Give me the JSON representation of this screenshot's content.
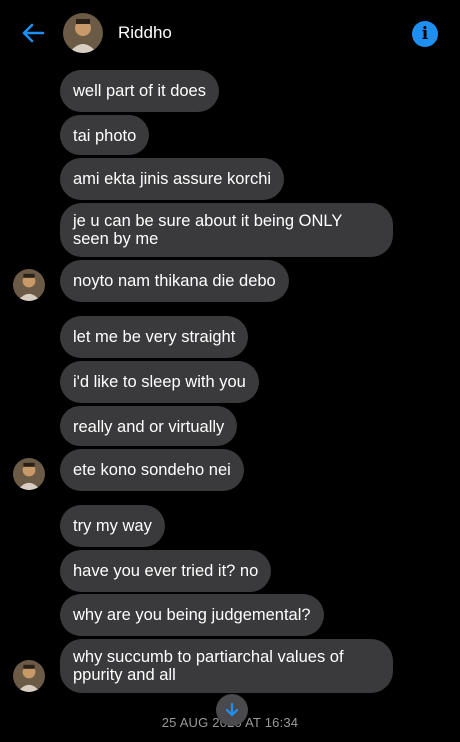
{
  "header": {
    "contact_name": "Riddho",
    "back_icon": "arrow-left-icon",
    "info_icon": "info-icon",
    "accent_color": "#1e8ff5"
  },
  "messages": [
    "well part of it does",
    "tai photo",
    "ami ekta jinis assure korchi",
    "je u can be sure about it being ONLY seen by me",
    "noyto nam thikana die debo",
    "let me be very straight",
    "i'd like to sleep with you",
    "really and or virtually",
    "ete kono sondeho nei",
    "try my way",
    "have you ever tried it? no",
    "why are you being judgemental?",
    "why succumb to partiarchal values of ppurity and all"
  ],
  "footer": {
    "timestamp": "25 AUG 2020 AT 16:34",
    "scroll_icon": "arrow-down-icon"
  },
  "colors": {
    "background": "#000000",
    "bubble": "#3a3a3c"
  }
}
